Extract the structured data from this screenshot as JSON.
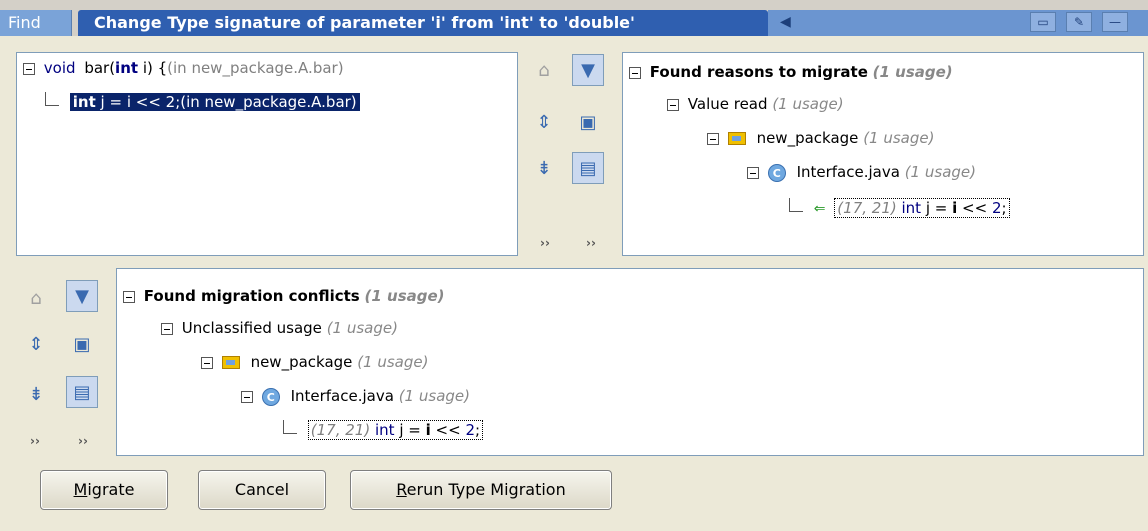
{
  "titlebar": {
    "find_label": "Find",
    "title": "Change Type signature of parameter 'i' from 'int' to 'double'"
  },
  "left_tree": {
    "root": {
      "prefix": "void",
      "name": "bar(",
      "param_kw": "int",
      "param_rest": " i) {",
      "location": "(in new_package.A.bar)"
    },
    "child": {
      "kw": "int",
      "code": " j = i << 2;",
      "location": "(in new_package.A.bar)"
    }
  },
  "right_tree": {
    "root_label": "Found reasons to migrate",
    "root_usage": "(1 usage)",
    "l1_label": "Value read",
    "l1_usage": "(1 usage)",
    "l2_label": "new_package",
    "l2_usage": "(1 usage)",
    "l3_label": "Interface.java",
    "l3_usage": "(1 usage)",
    "leaf_pos": "(17, 21)",
    "leaf_kw": "int",
    "leaf_a": " j = ",
    "leaf_b": "i",
    "leaf_c": " << ",
    "leaf_d": "2",
    "leaf_e": ";"
  },
  "bottom_tree": {
    "root_label": "Found migration conflicts",
    "root_usage": "(1 usage)",
    "l1_label": "Unclassified usage",
    "l1_usage": "(1 usage)",
    "l2_label": "new_package",
    "l2_usage": "(1 usage)",
    "l3_label": "Interface.java",
    "l3_usage": "(1 usage)",
    "leaf_pos": "(17, 21)",
    "leaf_kw": "int",
    "leaf_a": " j = ",
    "leaf_b": "i",
    "leaf_c": " << ",
    "leaf_d": "2",
    "leaf_e": ";"
  },
  "buttons": {
    "migrate_u": "M",
    "migrate_rest": "igrate",
    "cancel": "Cancel",
    "rerun_u": "R",
    "rerun_rest": "erun Type Migration"
  },
  "icons": {
    "class_letter": "C",
    "chevrons": "››"
  }
}
